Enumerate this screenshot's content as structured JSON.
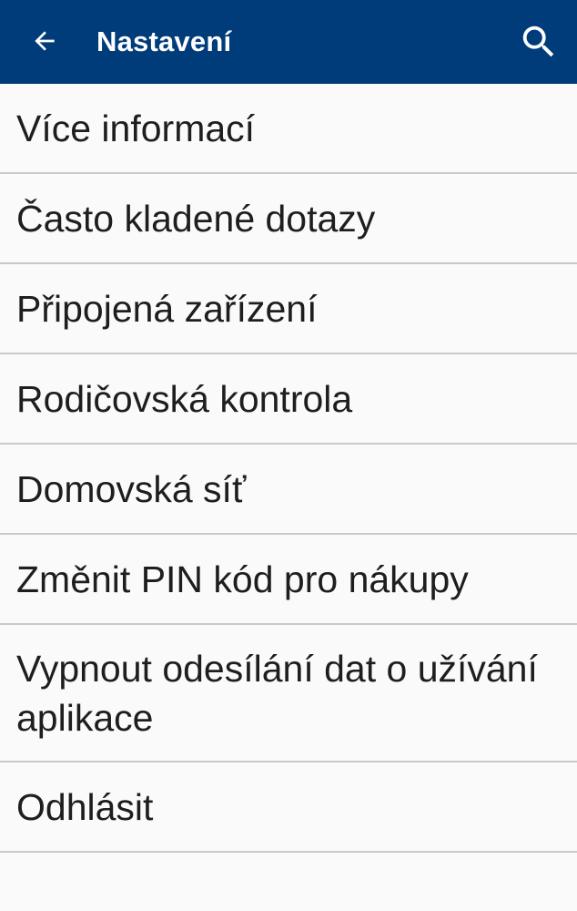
{
  "toolbar": {
    "title": "Nastavení",
    "back_icon": "arrow-left-icon",
    "search_icon": "search-icon",
    "background_color": "#003b7a"
  },
  "settings": {
    "items": [
      {
        "label": "Více informací"
      },
      {
        "label": "Často kladené dotazy"
      },
      {
        "label": "Připojená zařízení"
      },
      {
        "label": "Rodičovská kontrola"
      },
      {
        "label": "Domovská síť"
      },
      {
        "label": "Změnit PIN kód pro nákupy"
      },
      {
        "label": "Vypnout odesílání dat o užívání aplikace"
      },
      {
        "label": "Odhlásit"
      }
    ]
  }
}
